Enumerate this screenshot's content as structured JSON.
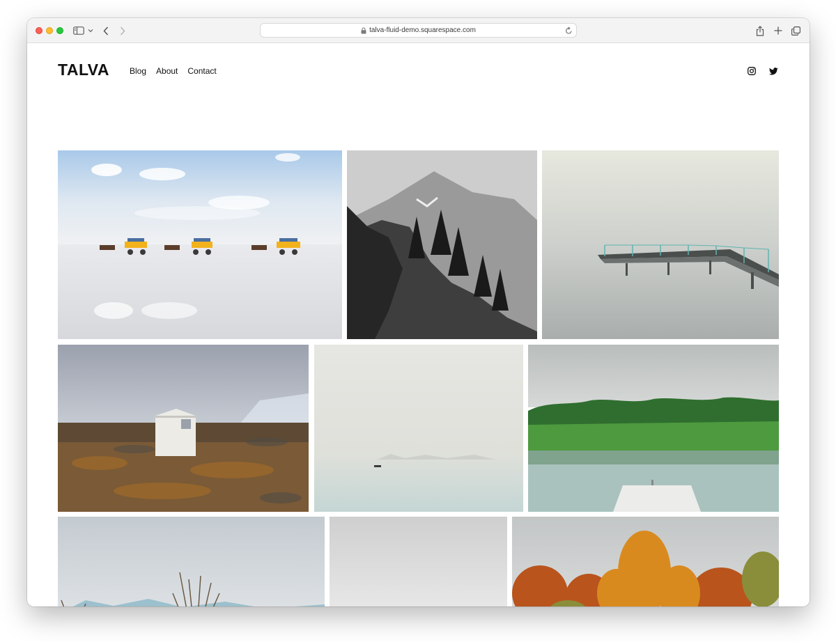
{
  "browser": {
    "url": "talva-fluid-demo.squarespace.com"
  },
  "site": {
    "title": "TALVA",
    "nav": [
      {
        "label": "Blog"
      },
      {
        "label": "About"
      },
      {
        "label": "Contact"
      }
    ],
    "social": [
      "instagram-icon",
      "twitter-icon"
    ]
  },
  "gallery": [
    {
      "scene": "horse-carriages-on-tidal-flats"
    },
    {
      "scene": "black-and-white-mountain-cliff"
    },
    {
      "scene": "misty-pier"
    },
    {
      "scene": "white-hut-on-tundra"
    },
    {
      "scene": "boat-on-misty-sea"
    },
    {
      "scene": "green-forest-lake-dock"
    },
    {
      "scene": "frozen-shore-grass"
    },
    {
      "scene": "foggy-grey-sea"
    },
    {
      "scene": "autumn-trees"
    }
  ],
  "colors": {
    "text": "#111111",
    "toolbar": "#f3f3f3"
  }
}
